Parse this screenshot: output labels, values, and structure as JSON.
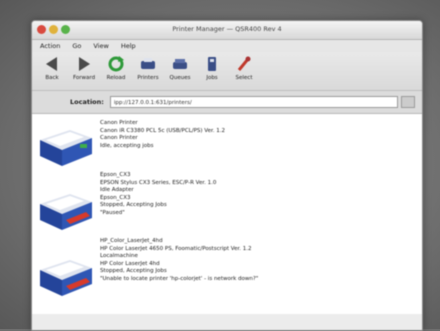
{
  "window": {
    "title": "Printer Manager — QSR400 Rev 4"
  },
  "menu": [
    "Action",
    "Go",
    "View",
    "Help"
  ],
  "toolbar": {
    "buttons": [
      {
        "label": "Back",
        "icon": "back-arrow-icon"
      },
      {
        "label": "Forward",
        "icon": "forward-arrow-icon"
      },
      {
        "label": "Reload",
        "icon": "reload-icon"
      },
      {
        "label": "Printers",
        "icon": "printers-icon"
      },
      {
        "label": "Queues",
        "icon": "queues-icon"
      },
      {
        "label": "Jobs",
        "icon": "jobs-icon"
      },
      {
        "label": "Select",
        "icon": "select-icon"
      }
    ]
  },
  "location": {
    "label": "Location:",
    "value": "ipp://127.0.0.1:631/printers/"
  },
  "printers": [
    {
      "lines": [
        "Canon Printer",
        "Canon iR C3380 PCL 5c (USB/PCL/PS) Ver. 1.2",
        "Canon Printer",
        "Idle, accepting jobs"
      ]
    },
    {
      "lines": [
        "Epson_CX3",
        "EPSON Stylus CX3 Series, ESC/P-R Ver. 1.0",
        "Idle Adapter",
        "Epson_CX3",
        "Stopped, Accepting Jobs",
        "\"Paused\""
      ]
    },
    {
      "lines": [
        "HP_Color_LaserJet_4hd",
        "HP Color LaserJet 4650 PS, Foomatic/Postscript Ver. 1.2",
        "Localmachine",
        "HP Color LaserJet 4hd",
        "Stopped, Accepting Jobs",
        "\"Unable to locate printer 'hp-colorjet' - is network down?\""
      ]
    }
  ],
  "colors": {
    "window_bg": "#ececec",
    "content_bg": "#ffffff",
    "printer_blue": "#2a4a9a",
    "tray_red": "#d83a2a"
  }
}
